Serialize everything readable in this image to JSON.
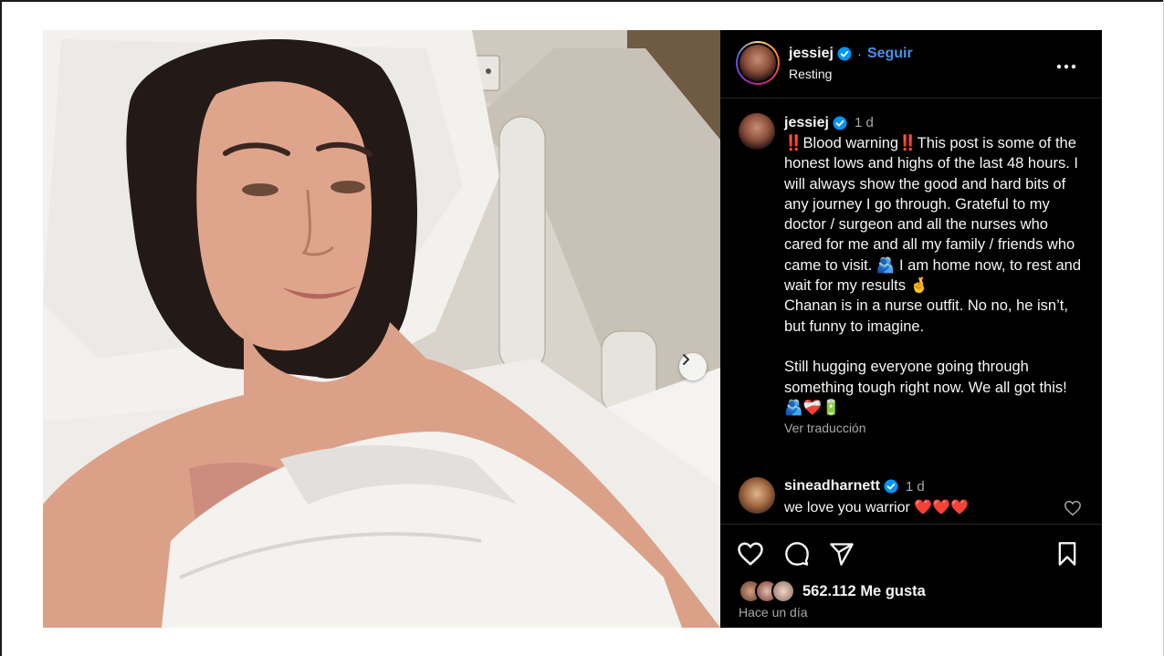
{
  "post": {
    "username": "jessiej",
    "follow_label": "Seguir",
    "separator": "·",
    "location": "Resting",
    "more_label": "More options"
  },
  "caption": {
    "username": "jessiej",
    "time": "1 d",
    "text": "‼️Blood warning‼️This post is some of the honest lows and highs of the last 48 hours. I will always show the good and hard bits of any journey I go through. Grateful to my doctor / surgeon and all the nurses who cared for me and all my family / friends who came to visit. 🫂 I am home now, to rest and wait for my results 🤞\nChanan is in a nurse outfit. No no, he isn’t, but funny to imagine.\n\nStill hugging everyone going through something tough right now. We all got this! 🫂❤️‍🩹🔋",
    "translate_label": "Ver traducción"
  },
  "comment": {
    "username": "sineadharnett",
    "time": "1 d",
    "text": "we love you warrior ❤️❤️❤️"
  },
  "stats": {
    "likes": "562.112 Me gusta",
    "time_ago": "Hace un día"
  },
  "colors": {
    "accent": "#4a8fe8",
    "background": "#000000",
    "secondary_text": "#a8a8a8",
    "verified": "#0095f6"
  },
  "icons": [
    "next-arrow-icon",
    "verified-icon",
    "more-icon",
    "heart-icon",
    "comment-icon",
    "share-icon",
    "bookmark-icon"
  ]
}
